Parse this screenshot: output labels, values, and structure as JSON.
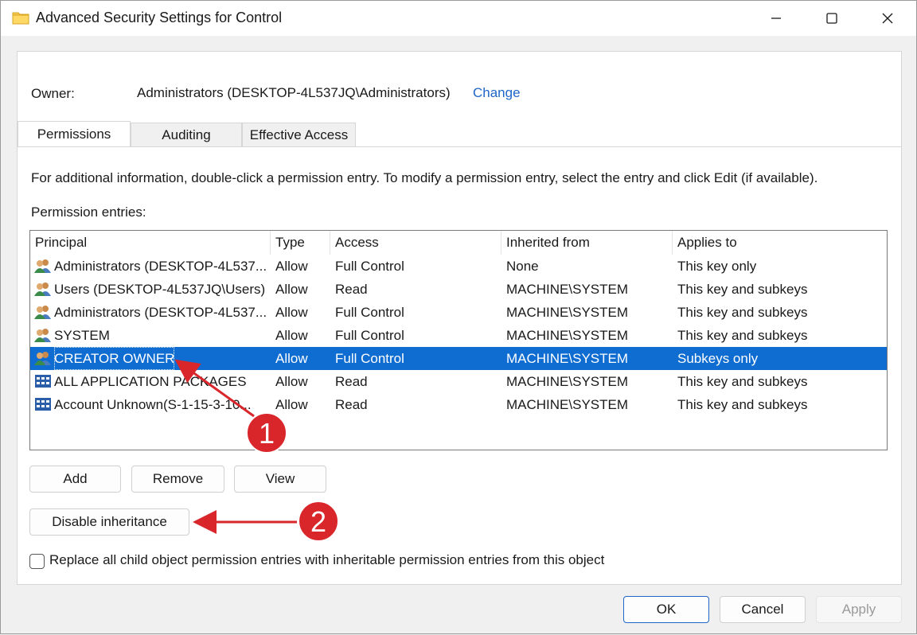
{
  "window": {
    "title": "Advanced Security Settings for Control",
    "icons": {
      "app": "folder-icon",
      "minimize": "minimize-icon",
      "maximize": "maximize-icon",
      "close": "close-icon"
    }
  },
  "owner": {
    "label": "Owner:",
    "value": "Administrators (DESKTOP-4L537JQ\\Administrators)",
    "change_link": "Change"
  },
  "tabs": [
    {
      "label": "Permissions",
      "active": true
    },
    {
      "label": "Auditing",
      "active": false
    },
    {
      "label": "Effective Access",
      "active": false
    }
  ],
  "info_text": "For additional information, double-click a permission entry. To modify a permission entry, select the entry and click Edit (if available).",
  "entries_label": "Permission entries:",
  "list": {
    "columns": [
      "Principal",
      "Type",
      "Access",
      "Inherited from",
      "Applies to"
    ],
    "rows": [
      {
        "principal": "Administrators (DESKTOP-4L537...",
        "type": "Allow",
        "access": "Full Control",
        "inherited": "None",
        "applies": "This key only",
        "icon": "group-users-icon",
        "selected": false
      },
      {
        "principal": "Users (DESKTOP-4L537JQ\\Users)",
        "type": "Allow",
        "access": "Read",
        "inherited": "MACHINE\\SYSTEM",
        "applies": "This key and subkeys",
        "icon": "group-users-icon",
        "selected": false
      },
      {
        "principal": "Administrators (DESKTOP-4L537...",
        "type": "Allow",
        "access": "Full Control",
        "inherited": "MACHINE\\SYSTEM",
        "applies": "This key and subkeys",
        "icon": "group-users-icon",
        "selected": false
      },
      {
        "principal": "SYSTEM",
        "type": "Allow",
        "access": "Full Control",
        "inherited": "MACHINE\\SYSTEM",
        "applies": "This key and subkeys",
        "icon": "group-users-icon",
        "selected": false
      },
      {
        "principal": "CREATOR OWNER",
        "type": "Allow",
        "access": "Full Control",
        "inherited": "MACHINE\\SYSTEM",
        "applies": "Subkeys only",
        "icon": "group-users-icon",
        "selected": true
      },
      {
        "principal": "ALL APPLICATION PACKAGES",
        "type": "Allow",
        "access": "Read",
        "inherited": "MACHINE\\SYSTEM",
        "applies": "This key and subkeys",
        "icon": "app-packages-icon",
        "selected": false
      },
      {
        "principal": "Account Unknown(S-1-15-3-10...",
        "type": "Allow",
        "access": "Read",
        "inherited": "MACHINE\\SYSTEM",
        "applies": "This key and subkeys",
        "icon": "app-packages-icon",
        "selected": false
      }
    ]
  },
  "buttons": {
    "add": "Add",
    "remove": "Remove",
    "view": "View",
    "disable_inheritance": "Disable inheritance",
    "ok": "OK",
    "cancel": "Cancel",
    "apply": "Apply"
  },
  "checkbox": {
    "label": "Replace all child object permission entries with inheritable permission entries from this object",
    "checked": false
  },
  "annotations": [
    {
      "number": "1",
      "color": "#d9262b"
    },
    {
      "number": "2",
      "color": "#d9262b"
    }
  ],
  "colors": {
    "selection": "#0f6cd1",
    "link": "#1e66c8",
    "annotation": "#d9262b"
  }
}
